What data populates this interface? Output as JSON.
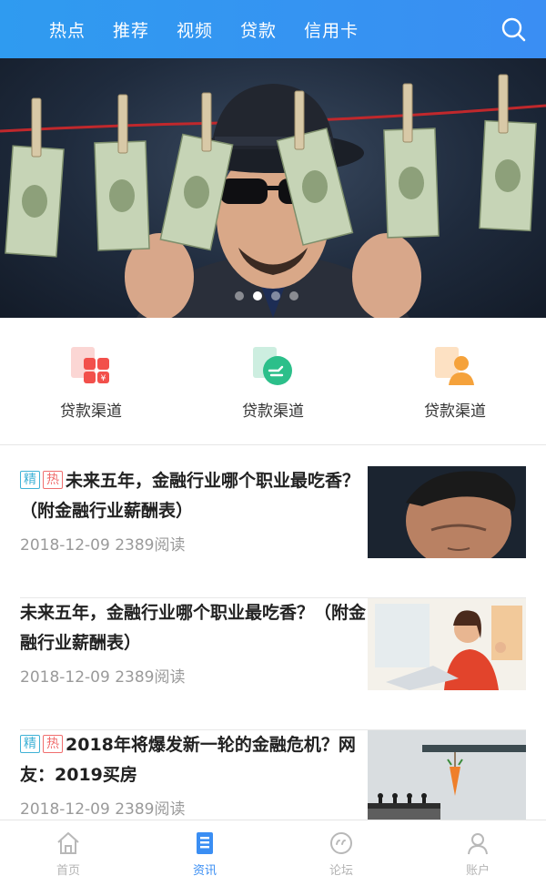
{
  "topnav": {
    "tabs": [
      "热点",
      "推荐",
      "视频",
      "贷款",
      "信用卡"
    ],
    "search_icon": "search-icon"
  },
  "banner": {
    "dots_total": 4,
    "active_dot": 2
  },
  "quick_entries": [
    {
      "label": "贷款渠道",
      "icon": "loan-red-icon",
      "color": "#f2504b"
    },
    {
      "label": "贷款渠道",
      "icon": "loan-green-icon",
      "color": "#2cbf8a"
    },
    {
      "label": "贷款渠道",
      "icon": "loan-orange-icon",
      "color": "#f5a23b"
    }
  ],
  "news": [
    {
      "badges": [
        "精",
        "热"
      ],
      "title": "未来五年，金融行业哪个职业最吃香？（附金融行业薪酬表）",
      "date": "2018-12-09",
      "reads": "2389阅读"
    },
    {
      "badges": [],
      "title": "未来五年，金融行业哪个职业最吃香？（附金融行业薪酬表）",
      "date": "2018-12-09",
      "reads": "2389阅读"
    },
    {
      "badges": [
        "精",
        "热"
      ],
      "title": "2018年将爆发新一轮的金融危机？网友：2019买房",
      "date": "2018-12-09",
      "reads": "2389阅读"
    }
  ],
  "tabbar": {
    "items": [
      {
        "label": "首页",
        "icon": "home-icon",
        "active": false
      },
      {
        "label": "资讯",
        "icon": "news-icon",
        "active": true
      },
      {
        "label": "论坛",
        "icon": "forum-icon",
        "active": false
      },
      {
        "label": "账户",
        "icon": "account-icon",
        "active": false
      }
    ]
  },
  "colors": {
    "accent": "#3a8ef3",
    "badge_jing": "#3fb2d6",
    "badge_re": "#f06e6e"
  }
}
